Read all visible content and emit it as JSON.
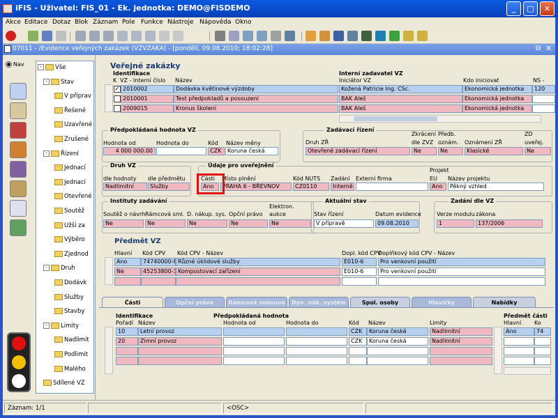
{
  "window": {
    "title": "iFIS - Uživatel: FIS_01 - Ek. jednotka: DEMO@FISDEMO"
  },
  "menu": [
    "Akce",
    "Editace",
    "Dotaz",
    "Blok",
    "Záznam",
    "Pole",
    "Funkce",
    "Nástroje",
    "Nápověda",
    "Okno"
  ],
  "toolbar_icons": [
    "exit-icon",
    "add-record-icon",
    "save-icon",
    "delete-icon",
    "query-icon",
    "filter-icon",
    "sort-icon",
    "cut-icon",
    "copy-icon",
    "search-icon",
    "zoom-icon",
    "print-icon",
    "export-icon",
    "settings-icon",
    "tools-icon",
    "word-icon",
    "excel-icon",
    "email-icon",
    "help-icon"
  ],
  "document": {
    "title": "07011 - /Evidence veřejných zakázek (VZVZAKA) - [pondělí, 09.08.2010; 18:02:28]"
  },
  "nav": {
    "radio_label": "Nav",
    "tree": [
      {
        "label": "Vše",
        "level": 0,
        "pm": "-"
      },
      {
        "label": "Stav",
        "level": 1,
        "pm": "-"
      },
      {
        "label": "V příprav",
        "level": 2
      },
      {
        "label": "Řešené",
        "level": 2
      },
      {
        "label": "Uzavřené",
        "level": 2
      },
      {
        "label": "Zrušené",
        "level": 2
      },
      {
        "label": "Řízení",
        "level": 1,
        "pm": "-"
      },
      {
        "label": "Jednací",
        "level": 2
      },
      {
        "label": "Jednací",
        "level": 2
      },
      {
        "label": "Otevřené",
        "level": 2
      },
      {
        "label": "Soutěž",
        "level": 2
      },
      {
        "label": "Užší za",
        "level": 2
      },
      {
        "label": "Výběro",
        "level": 2
      },
      {
        "label": "Zjednod",
        "level": 2
      },
      {
        "label": "Druh",
        "level": 1,
        "pm": "-"
      },
      {
        "label": "Dodávk",
        "level": 2
      },
      {
        "label": "Služby",
        "level": 2
      },
      {
        "label": "Stavby",
        "level": 2
      },
      {
        "label": "Limity",
        "level": 1,
        "pm": "-"
      },
      {
        "label": "Nadlimit",
        "level": 2
      },
      {
        "label": "Podlimit",
        "level": 2
      },
      {
        "label": "Malého",
        "level": 2
      },
      {
        "label": "Sdílené VZ",
        "level": 1
      }
    ]
  },
  "main": {
    "section_title": "Veřejné zakázky",
    "vz_table": {
      "group_left": "Identifikace",
      "group_right": "Interní zadavatel VZ",
      "col_k": "K",
      "col_vz": "VZ - Interní číslo",
      "col_nazev": "Název",
      "col_iniciator": "Iniciátor VZ",
      "col_kod": "Kdo iniciovat",
      "col_ns": "NS - ",
      "rows": [
        {
          "checked": true,
          "vz": "2010002",
          "nazev": "Dodávka květinové výzdoby",
          "iniciator": "Kožená Patricie Ing. CSc.",
          "kod": "Ekonomická jednotka",
          "ns": "120"
        },
        {
          "checked": false,
          "vz": "2010001",
          "nazev": "Test předpokladů a posouzení",
          "iniciator": "BAK Aleš",
          "kod": "Ekonomická jednotka",
          "ns": ""
        },
        {
          "checked": false,
          "vz": "2009015",
          "nazev": "Kronus školení",
          "iniciator": "BAK Aleš",
          "kod": "Ekonomická jednotka",
          "ns": ""
        }
      ]
    },
    "hodnota": {
      "title": "Předpokládaná hodnota VZ",
      "lbl_od": "Hodnota od",
      "lbl_do": "Hodnota do",
      "lbl_kod": "Kód",
      "lbl_mena": "Název měny",
      "od": "4 000 000.00",
      "do": "",
      "kod": "CZK",
      "mena": "Koruna česká"
    },
    "zadavaci": {
      "title": "Zadávací řízení",
      "lbl_druh": "Druh ZŘ",
      "lbl_zkr1": "Zkrácení",
      "lbl_zkr2": "dle ZVZ",
      "lbl_pred1": "Předb.",
      "lbl_pred2": "oznám.",
      "lbl_ozn": "Oznámení ZŘ",
      "lbl_zd1": "ZD",
      "lbl_zd2": "uveřej.",
      "druh": "Otevřené zadávací řízení",
      "zkr": "Ne",
      "pred": "Ne",
      "ozn": "Klasické",
      "zd": "Ne"
    },
    "druh_vz": {
      "title": "Druh VZ",
      "lbl_hodnoty": "dle hodnoty",
      "lbl_predmetu": "dle předmětu",
      "hodnoty": "Nadlimitní",
      "predmetu": "Služby"
    },
    "uverejneni": {
      "title": "Údaje pro uveřejnění",
      "lbl_casti": "Části",
      "lbl_misto": "Místo plnění",
      "lbl_nuts": "Kód NUTS",
      "lbl_zadani": "Zadání",
      "lbl_firma": "Externí firma",
      "lbl_projekt": "Projekt",
      "lbl_eu": "EU",
      "lbl_nazev_proj": "Název projektu",
      "casti": "Ano",
      "misto": "PRAHA 6 - BŘEVNOV",
      "nuts": "CZ0110",
      "zadani": "Interně",
      "firma": "",
      "eu": "Ano",
      "nazev_proj": "Pěkný vzhled"
    },
    "instituty": {
      "title": "Instituty zadávání",
      "lbl_soutez": "Soutěž o návrh",
      "lbl_ramc": "Rámcová sml.",
      "lbl_dnak": "D. nákup. sys.",
      "lbl_opc": "Opční právo",
      "lbl_el1": "Elektron.",
      "lbl_el2": "aukce",
      "soutez": "Ne",
      "ramc": "Ne",
      "dnak": "Ne",
      "opc": "Ne",
      "el": "Ne"
    },
    "aktualni": {
      "title": "Aktuální stav",
      "lbl_stav": "Stav řízení",
      "lbl_datum": "Datum evidence",
      "stav": "V přípravě",
      "datum": "09.08.2010"
    },
    "zadani": {
      "title": "Zadání dle VZ",
      "lbl_verze": "Verze modulu",
      "lbl_zakona": "zákona",
      "verze": "1",
      "zakona": "137/2006"
    },
    "predmet": {
      "title": "Předmět VZ",
      "col_hlavni": "Hlavní",
      "col_kod": "Kód CPV",
      "col_nazev": "Kód CPV - Název",
      "col_dkod": "Dopl. kód CPV",
      "col_dnazev": "Doplňkový kód CPV - Název",
      "rows": [
        {
          "hlavni": "Ano",
          "kod": "74740000-8",
          "nazev": "Různé úklidové služby",
          "dkod": "E010-6",
          "dnazev": "Pro venkovní použití"
        },
        {
          "hlavni": "Ne",
          "kod": "45253800-3",
          "nazev": "Kompostovací zařízení",
          "dkod": "E010-6",
          "dnazev": "Pro venkovní použití"
        }
      ]
    },
    "tabs": [
      "Části",
      "Opční právo",
      "Rámcová smlouva",
      "Dyn. nák. systém",
      "Spol. osoby",
      "Hlavičky",
      "Nabídky"
    ],
    "casti_table": {
      "group_id": "Identifikace",
      "group_hod": "Předpokládaná hodnota",
      "group_pred": "Předmět části",
      "col_poradi": "Pořadí",
      "col_nazev": "Název",
      "col_od": "Hodnota od",
      "col_do": "Hodnota do",
      "col_kod": "Kód",
      "col_mena": "Název",
      "col_limity": "Limity",
      "col_hlavni": "Hlavní",
      "col_ko": "Ko",
      "rows": [
        {
          "poradi": "10",
          "nazev": "Letní provoz",
          "od": "",
          "do": "",
          "kod": "CZK",
          "mena": "Koruna česká",
          "limity": "Nadlimitní",
          "hlavni": "Ano",
          "ko": "74"
        },
        {
          "poradi": "20",
          "nazev": "Zimní provoz",
          "od": "",
          "do": "",
          "kod": "CZK",
          "mena": "Koruna česká",
          "limity": "Nadlimitní",
          "hlavni": "",
          "ko": ""
        }
      ]
    }
  },
  "status": {
    "zaznam": "Záznam: 1/1",
    "osc": "<OSC>"
  }
}
